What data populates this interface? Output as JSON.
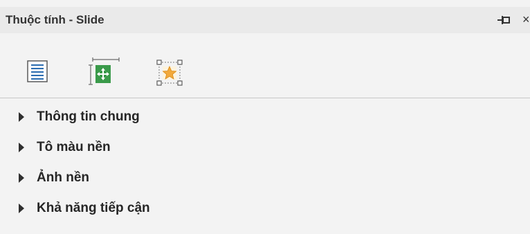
{
  "panel": {
    "title": "Thuộc tính - Slide",
    "close_glyph": "×",
    "pin_icon": "pin-icon",
    "tabs": [
      {
        "icon": "list-properties-icon",
        "selected": true
      },
      {
        "icon": "size-position-icon",
        "selected": false
      },
      {
        "icon": "effects-star-icon",
        "selected": false
      }
    ],
    "sections": [
      {
        "label": "Thông tin chung",
        "expanded": false
      },
      {
        "label": "Tô màu nền",
        "expanded": false
      },
      {
        "label": "Ảnh nền",
        "expanded": false
      },
      {
        "label": "Khả năng tiếp cận",
        "expanded": false
      }
    ]
  },
  "colors": {
    "panel_bg": "#f3f3f3",
    "titlebar_bg": "#eaeaea",
    "icon_blue": "#2b6cb0",
    "icon_green": "#3a9a4a",
    "star_orange": "#f2a93b"
  }
}
